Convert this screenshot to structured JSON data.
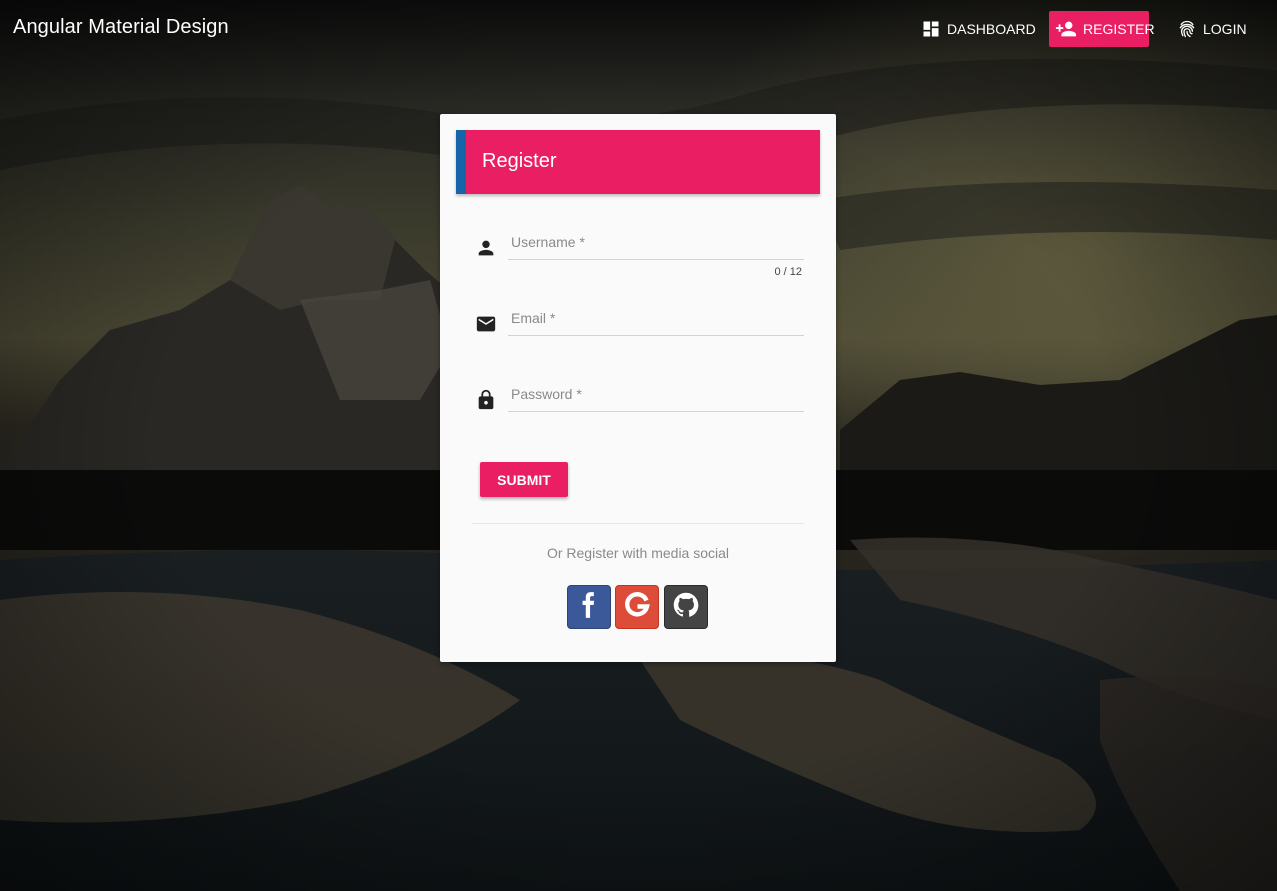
{
  "app": {
    "title": "Angular Material Design"
  },
  "nav": {
    "dashboard": "DASHBOARD",
    "register": "REGISTER",
    "login": "LOGIN"
  },
  "card": {
    "title": "Register",
    "fields": {
      "username": {
        "label": "Username *",
        "value": "",
        "hint": "0 / 12"
      },
      "email": {
        "label": "Email *",
        "value": ""
      },
      "password": {
        "label": "Password *",
        "value": ""
      }
    },
    "submit_label": "SUBMIT",
    "social_text": "Or Register with media social"
  },
  "colors": {
    "accent": "#e91e63",
    "header_stripe": "#1565a8",
    "facebook": "#3b5998",
    "google": "#dd4b39",
    "github": "#444444"
  },
  "icons": {
    "nav_dashboard": "dashboard-icon",
    "nav_register": "person-add-icon",
    "nav_login": "fingerprint-icon",
    "username": "person-icon",
    "email": "mail-icon",
    "password": "lock-icon",
    "social": [
      "facebook-icon",
      "google-icon",
      "github-icon"
    ]
  }
}
